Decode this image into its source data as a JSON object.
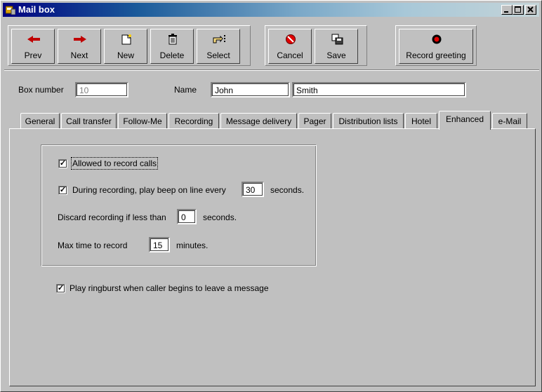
{
  "window": {
    "title": "Mail box",
    "controls": [
      "_",
      "□",
      "×"
    ]
  },
  "toolbar": {
    "buttons": [
      {
        "label": "Prev",
        "icon": "left-arrow-icon"
      },
      {
        "label": "Next",
        "icon": "right-arrow-icon"
      },
      {
        "label": "New",
        "icon": "new-document-icon"
      },
      {
        "label": "Delete",
        "icon": "trash-icon"
      },
      {
        "label": "Select",
        "icon": "select-hand-icon"
      },
      {
        "label": "Cancel",
        "icon": "cancel-icon"
      },
      {
        "label": "Save",
        "icon": "save-icon"
      },
      {
        "label": "Record greeting",
        "icon": "record-icon"
      }
    ]
  },
  "header": {
    "box_number_label": "Box number",
    "box_number_value": "10",
    "name_label": "Name",
    "first_name": "John",
    "last_name": "Smith"
  },
  "tabs": [
    {
      "label": "General"
    },
    {
      "label": "Call transfer"
    },
    {
      "label": "Follow-Me"
    },
    {
      "label": "Recording"
    },
    {
      "label": "Message delivery"
    },
    {
      "label": "Pager"
    },
    {
      "label": "Distribution lists"
    },
    {
      "label": "Hotel"
    },
    {
      "label": "Enhanced",
      "active": true
    },
    {
      "label": "e-Mail"
    }
  ],
  "enhanced": {
    "allowed_to_record": {
      "label": "Allowed to record calls",
      "checked": true
    },
    "beep": {
      "label": "During recording, play beep on line every",
      "checked": true,
      "value": "30",
      "unit": "seconds."
    },
    "discard": {
      "label": "Discard recording if less than",
      "value": "0",
      "unit": "seconds."
    },
    "max_time": {
      "label": "Max time to record",
      "value": "15",
      "unit": "minutes."
    },
    "ringburst": {
      "label": "Play ringburst when caller begins to leave a message",
      "checked": true
    }
  },
  "colors": {
    "title_start": "#000080",
    "face": "#c0c0c0",
    "record_red": "#cc0000"
  }
}
